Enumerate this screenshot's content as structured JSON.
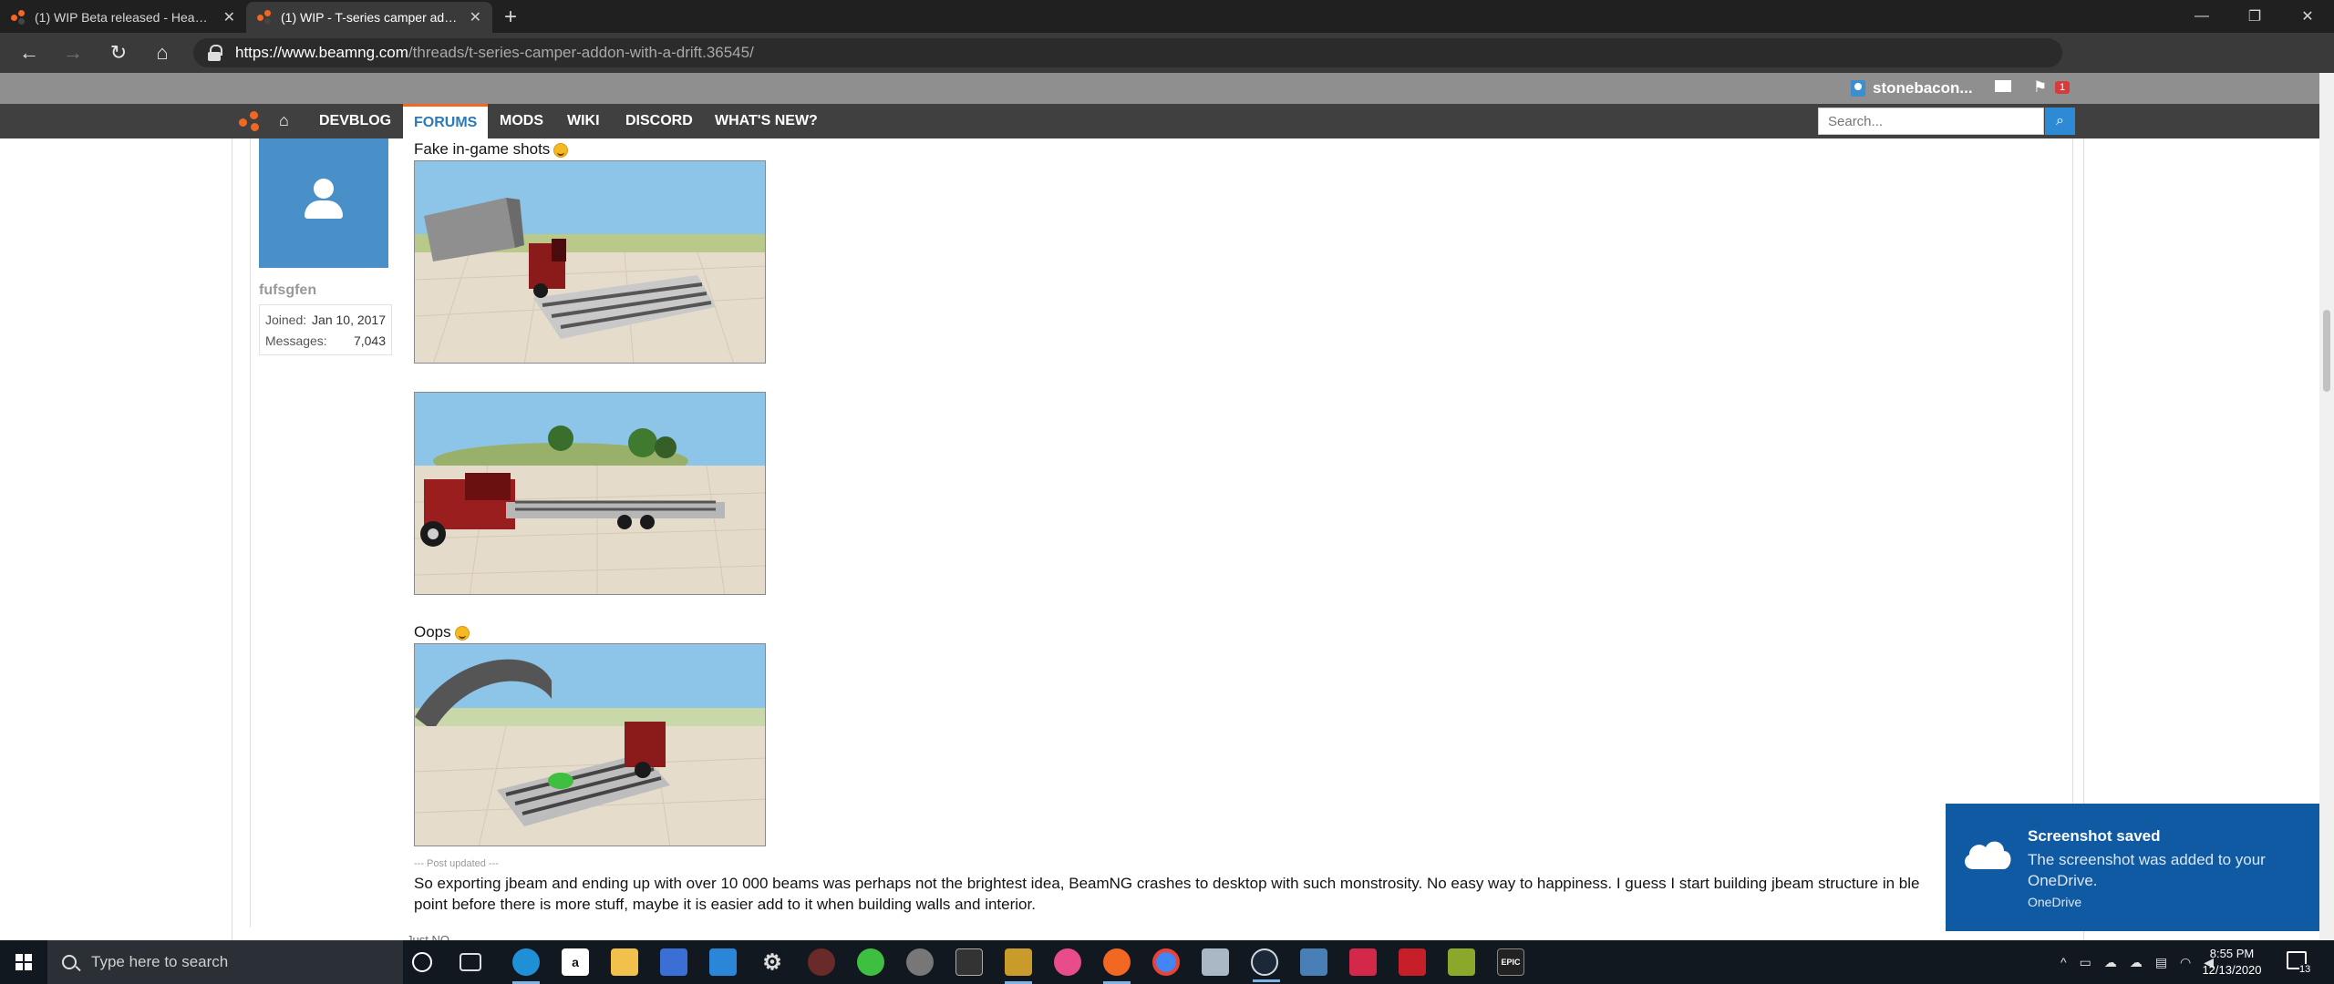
{
  "browser": {
    "tabs": [
      {
        "title": "(1) WIP Beta released - Heavy d..."
      },
      {
        "title": "(1) WIP - T-series camper addon..."
      }
    ],
    "new_tab": "+",
    "url_host": "https://www.beamng.com",
    "url_path": "/threads/t-series-camper-addon-with-a-drift.36545/"
  },
  "site": {
    "username": "stonebacon...",
    "alert_count": "1",
    "nav": [
      {
        "label": "DEVBLOG"
      },
      {
        "label": "FORUMS"
      },
      {
        "label": "MODS"
      },
      {
        "label": "WIKI"
      },
      {
        "label": "DISCORD"
      },
      {
        "label": "WHAT'S NEW?"
      }
    ],
    "search_placeholder": "Search..."
  },
  "post": {
    "author": "fufsgfen",
    "joined_label": "Joined:",
    "joined_value": "Jan 10, 2017",
    "messages_label": "Messages:",
    "messages_value": "7,043",
    "caption1": "Fake in-game shots",
    "caption2": "Oops",
    "updated_label": "--- Post updated ---",
    "body": "So exporting jbeam and ending up with over 10 000 beams was perhaps not the brightest idea, BeamNG crashes to desktop with such monstrosity. No easy way to happiness. I guess I start building jbeam structure in ble",
    "body2": "point before there is more stuff, maybe it is easier add to it when building walls and interior.",
    "next_line": "Just NO"
  },
  "toast": {
    "title": "Screenshot saved",
    "body": "The screenshot was added to your OneDrive.",
    "source": "OneDrive"
  },
  "taskbar": {
    "search_placeholder": "Type here to search",
    "time": "8:55 PM",
    "date": "12/13/2020",
    "notification_count": "13"
  },
  "colors": {
    "accent": "#2a7ab8",
    "brand_orange": "#f26722",
    "toast_bg": "#0f5aa3"
  }
}
